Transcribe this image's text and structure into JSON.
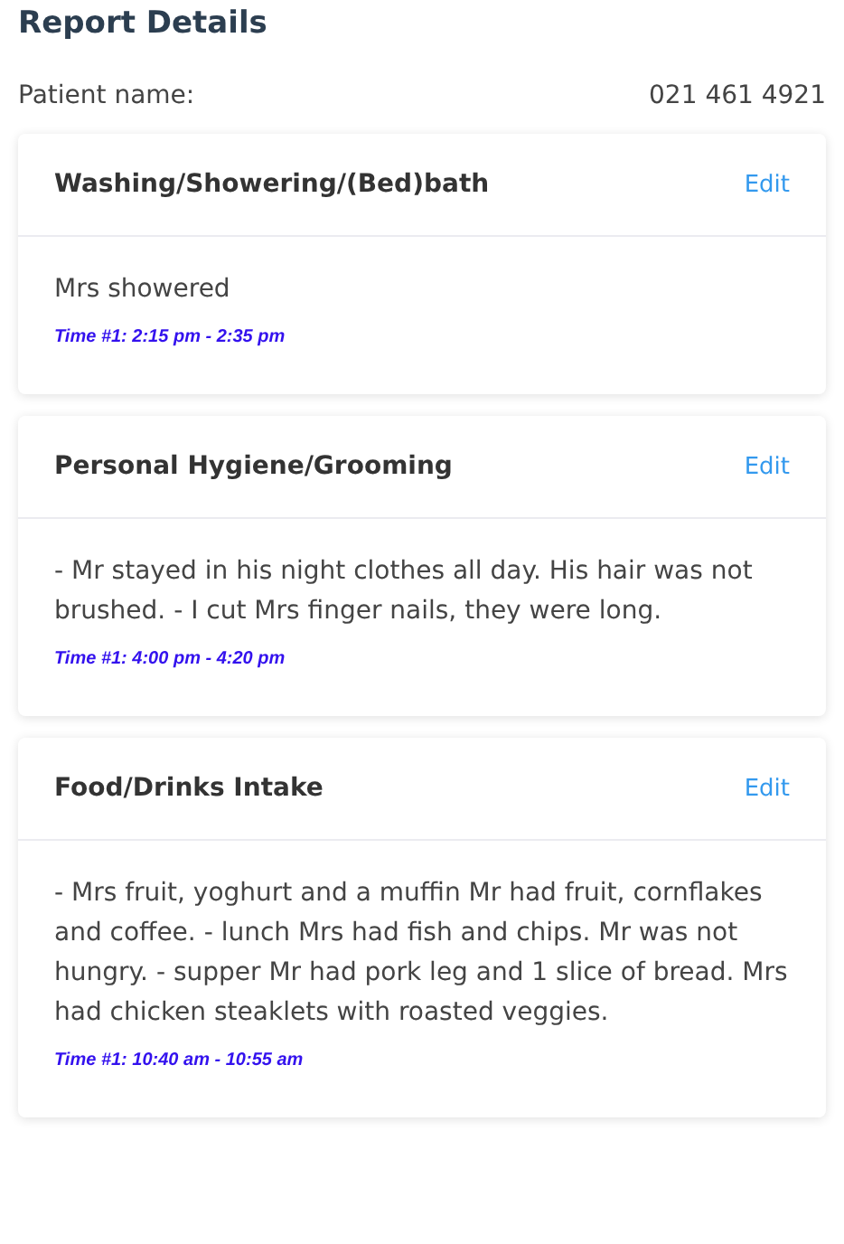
{
  "title": "Report Details",
  "patient": {
    "label": "Patient name:",
    "phone": "021 461 4921"
  },
  "sections": [
    {
      "title": "Washing/Showering/(Bed)bath",
      "action": "Edit",
      "note": "Mrs showered",
      "time": "Time #1: 2:15 pm - 2:35 pm"
    },
    {
      "title": "Personal Hygiene/Grooming",
      "action": "Edit",
      "note": "- Mr stayed in his night clothes all day. His hair was not brushed. - I cut Mrs finger nails, they were long.",
      "time": "Time #1: 4:00 pm - 4:20 pm"
    },
    {
      "title": "Food/Drinks Intake",
      "action": "Edit",
      "note": "- Mrs fruit, yoghurt and a muffin Mr had fruit, cornflakes and coffee. - lunch Mrs had fish and chips. Mr was not hungry. - supper Mr had pork leg and 1 slice of bread. Mrs had chicken steaklets with roasted veggies.",
      "time": "Time #1: 10:40 am - 10:55 am"
    }
  ]
}
